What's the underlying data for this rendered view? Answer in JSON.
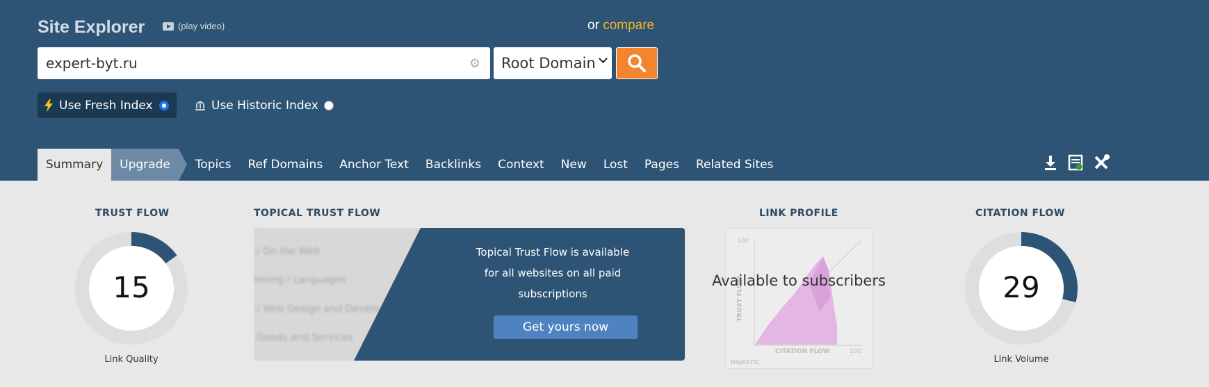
{
  "header": {
    "title": "Site Explorer",
    "video_label": "(play video)",
    "compare_prefix": "or",
    "compare_link": "compare"
  },
  "search": {
    "value": "expert-byt.ru",
    "scope": "Root Domain"
  },
  "index": {
    "fresh_label": "Use Fresh Index",
    "historic_label": "Use Historic Index",
    "selected": "fresh"
  },
  "tabs": [
    "Summary",
    "Upgrade",
    "Topics",
    "Ref Domains",
    "Anchor Text",
    "Backlinks",
    "Context",
    "New",
    "Lost",
    "Pages",
    "Related Sites"
  ],
  "trust_flow": {
    "title": "TRUST FLOW",
    "value": "15",
    "caption": "Link Quality"
  },
  "topical": {
    "title": "TOPICAL TRUST FLOW",
    "blurred_items": [
      "t / On the Web",
      "mming / Languages",
      "t / Web Design and Develo",
      "r Goods and Services"
    ],
    "message": "Topical Trust Flow is available for all websites on all paid subscriptions",
    "button": "Get yours now"
  },
  "link_profile": {
    "title": "LINK PROFILE",
    "overlay": "Available to subscribers",
    "y_tick": "100",
    "x_tick": "100",
    "y_label": "TRUST FLOW",
    "x_label": "CITATION FLOW",
    "watermark": "MAJESTIC"
  },
  "citation_flow": {
    "title": "CITATION FLOW",
    "value": "29",
    "caption": "Link Volume"
  },
  "colors": {
    "header_bg": "#2d5474",
    "accent_orange": "#f4852e",
    "compare_link": "#f5b323",
    "button_blue": "#4e82c1"
  }
}
